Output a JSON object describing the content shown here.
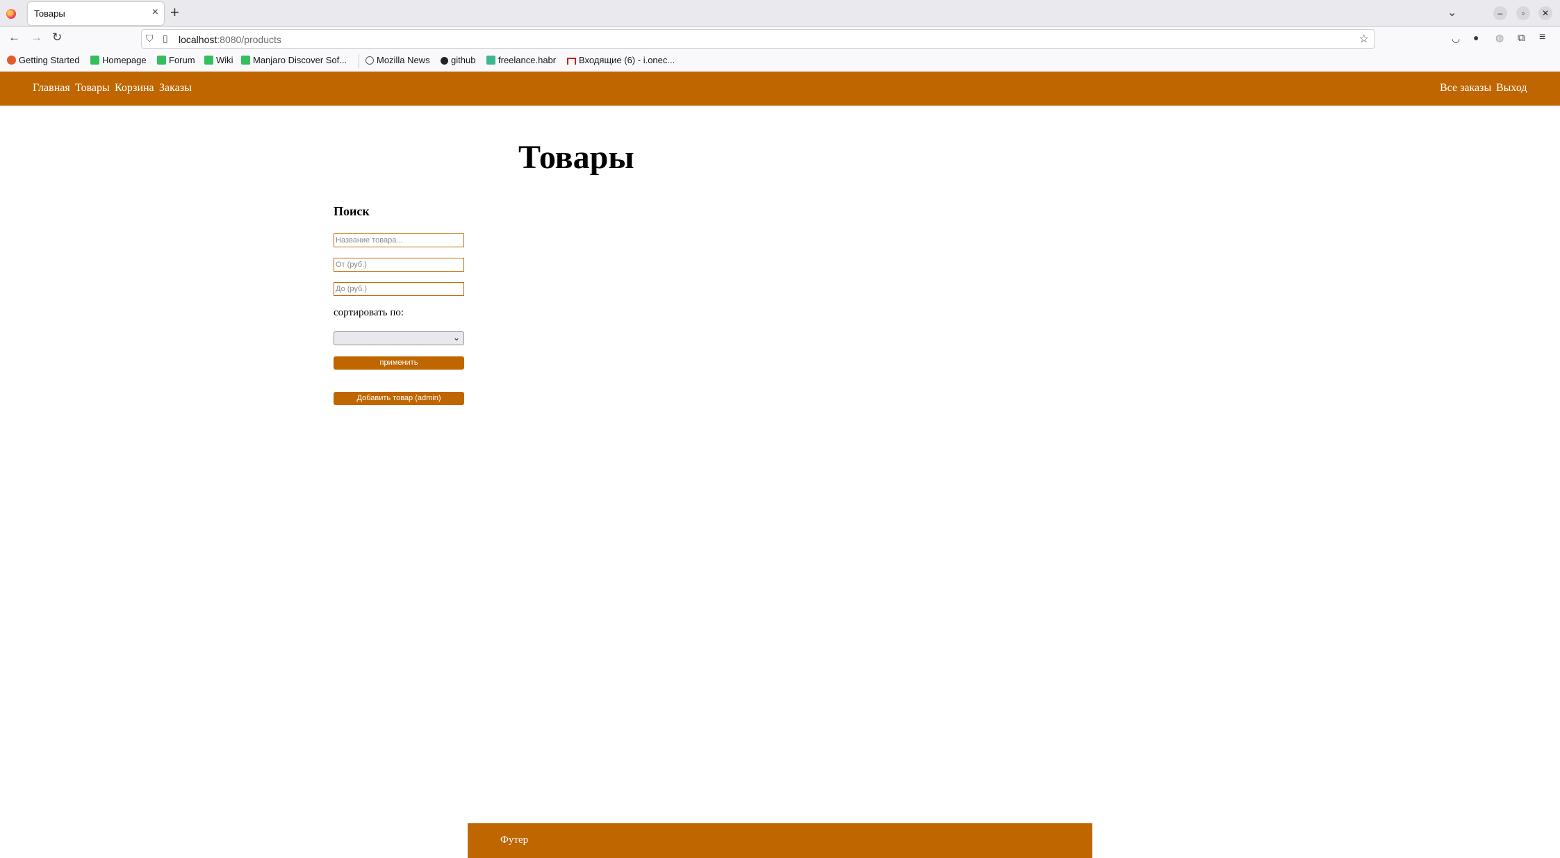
{
  "browser": {
    "tab": {
      "title": "Товары",
      "close": "×"
    },
    "new_tab": "+",
    "url": {
      "host": "localhost",
      "path": ":8080/products"
    },
    "bookmarks": [
      {
        "label": "Getting Started",
        "icon": "firefox-icon",
        "color": "#e55b2a"
      },
      {
        "label": "Homepage",
        "icon": "manjaro-icon",
        "color": "#35bf5c"
      },
      {
        "label": "Forum",
        "icon": "manjaro-icon",
        "color": "#35bf5c"
      },
      {
        "label": "Wiki",
        "icon": "manjaro-icon",
        "color": "#35bf5c"
      },
      {
        "label": "Manjaro Discover Sof...",
        "icon": "manjaro-icon",
        "color": "#35bf5c"
      },
      {
        "label": "Mozilla News",
        "icon": "globe-icon",
        "color": "#555555"
      },
      {
        "label": "github",
        "icon": "github-icon",
        "color": "#222222"
      },
      {
        "label": "freelance.habr",
        "icon": "habr-icon",
        "color": "#3fb68e"
      },
      {
        "label": "Входящие (6) - i.onec...",
        "icon": "gmail-icon",
        "color": "#c5221f"
      }
    ]
  },
  "header": {
    "nav": [
      "Главная",
      "Товары",
      "Корзина",
      "Заказы"
    ],
    "right": [
      "Все заказы",
      "Выход"
    ],
    "color": "#bf6600"
  },
  "main": {
    "title": "Товары",
    "search": {
      "title": "Поиск",
      "name_placeholder": "Название товара...",
      "from_placeholder": "От (руб.)",
      "to_placeholder": "До (руб.)",
      "sort_label": "сортировать по:",
      "sort_value": "",
      "apply_label": "применить",
      "add_label": "Добавить товар (admin)"
    }
  },
  "footer": {
    "text": "Футер"
  }
}
